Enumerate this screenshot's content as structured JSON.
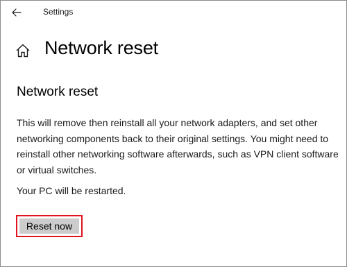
{
  "window": {
    "title": "Settings"
  },
  "icons": {
    "back": "back-arrow-icon",
    "home": "home-icon"
  },
  "page": {
    "title": "Network reset"
  },
  "section": {
    "title": "Network reset",
    "description": "This will remove then reinstall all your network adapters, and set other networking components back to their original settings. You might need to reinstall other networking software afterwards, such as VPN client software or virtual switches.",
    "restart_note": "Your PC will be restarted."
  },
  "actions": {
    "reset_label": "Reset now"
  },
  "colors": {
    "button_background": "#cccccc",
    "highlight_border": "#e0141e"
  }
}
